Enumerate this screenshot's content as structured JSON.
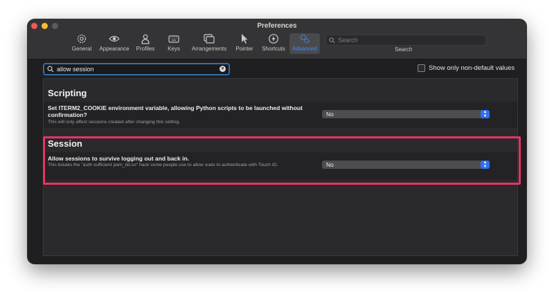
{
  "window": {
    "title": "Preferences"
  },
  "toolbar": {
    "items": [
      {
        "label": "General",
        "icon": "gear-icon"
      },
      {
        "label": "Appearance",
        "icon": "eye-icon"
      },
      {
        "label": "Profiles",
        "icon": "person-icon"
      },
      {
        "label": "Keys",
        "icon": "keyboard-icon"
      },
      {
        "label": "Arrangements",
        "icon": "windows-icon"
      },
      {
        "label": "Pointer",
        "icon": "cursor-icon"
      },
      {
        "label": "Shortcuts",
        "icon": "bolt-icon"
      },
      {
        "label": "Advanced",
        "icon": "gears-icon",
        "active": true
      }
    ],
    "search": {
      "placeholder": "Search",
      "caption": "Search"
    }
  },
  "filter": {
    "value": "allow session"
  },
  "non_default": {
    "label": "Show only non-default values",
    "checked": false
  },
  "sections": [
    {
      "title": "Scripting",
      "setting": {
        "label": "Set ITERM2_COOKIE environment variable, allowing Python scripts to be launched without confirmation?",
        "description": "This will only affect sessions created after changing this setting.",
        "value": "No"
      }
    },
    {
      "title": "Session",
      "setting": {
        "label": "Allow sessions to survive logging out and back in.",
        "description": "This breaks the \"auth sufficient pam_tid.so\" hack some people use to allow sudo to authenticate with Touch ID.",
        "value": "No"
      }
    }
  ],
  "colors": {
    "accent": "#3d8bf8",
    "highlight": "#ea3363",
    "popup_arrows": "#2d6ff0"
  }
}
